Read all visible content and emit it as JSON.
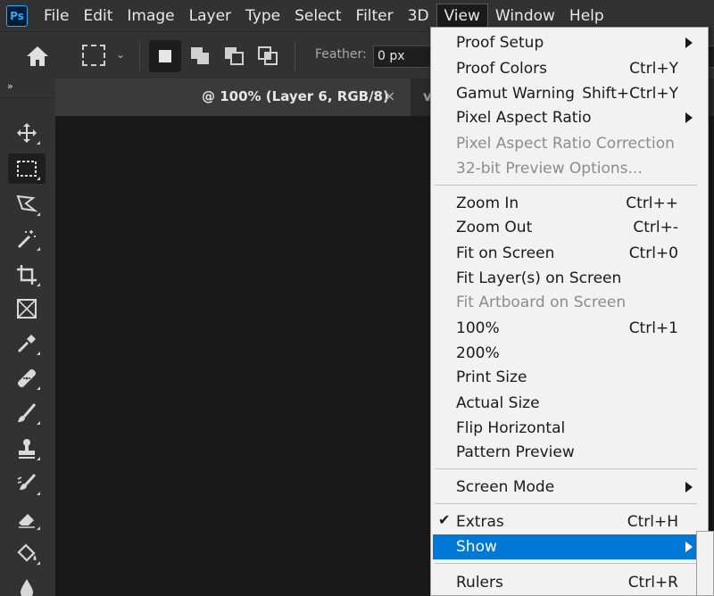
{
  "app": {
    "logo": "Ps"
  },
  "menubar": {
    "items": [
      "File",
      "Edit",
      "Image",
      "Layer",
      "Type",
      "Select",
      "Filter",
      "3D",
      "View",
      "Window",
      "Help"
    ],
    "active": "View"
  },
  "options": {
    "feather_label": "Feather:",
    "feather_value": "0 px"
  },
  "tools": {
    "collapse": "»",
    "items": [
      {
        "name": "move-tool-icon"
      },
      {
        "name": "rectangular-marquee-tool-icon",
        "selected": true
      },
      {
        "name": "lasso-tool-icon"
      },
      {
        "name": "magic-wand-tool-icon"
      },
      {
        "name": "crop-tool-icon"
      },
      {
        "name": "frame-tool-icon"
      },
      {
        "name": "eyedropper-tool-icon"
      },
      {
        "name": "spot-healing-brush-icon"
      },
      {
        "name": "brush-tool-icon"
      },
      {
        "name": "clone-stamp-tool-icon"
      },
      {
        "name": "history-brush-icon"
      },
      {
        "name": "eraser-tool-icon"
      },
      {
        "name": "paint-bucket-icon"
      },
      {
        "name": "blur-tool-icon"
      }
    ]
  },
  "document": {
    "tab_label": "@ 100% (Layer 6, RGB/8)",
    "tab_close": "×",
    "second_tab": "v"
  },
  "view_menu": {
    "proof_setup": "Proof Setup",
    "proof_colors": "Proof Colors",
    "proof_colors_sc": "Ctrl+Y",
    "gamut_warning": "Gamut Warning",
    "gamut_warning_sc": "Shift+Ctrl+Y",
    "pixel_aspect_ratio": "Pixel Aspect Ratio",
    "pixel_aspect_ratio_correction": "Pixel Aspect Ratio Correction",
    "preview_options": "32-bit Preview Options...",
    "zoom_in": "Zoom In",
    "zoom_in_sc": "Ctrl++",
    "zoom_out": "Zoom Out",
    "zoom_out_sc": "Ctrl+-",
    "fit_on_screen": "Fit on Screen",
    "fit_on_screen_sc": "Ctrl+0",
    "fit_layers": "Fit Layer(s) on Screen",
    "fit_artboard": "Fit Artboard on Screen",
    "zoom_100": "100%",
    "zoom_100_sc": "Ctrl+1",
    "zoom_200": "200%",
    "print_size": "Print Size",
    "actual_size": "Actual Size",
    "flip_horizontal": "Flip Horizontal",
    "pattern_preview": "Pattern Preview",
    "screen_mode": "Screen Mode",
    "extras": "Extras",
    "extras_sc": "Ctrl+H",
    "extras_check": "✔",
    "show": "Show",
    "rulers": "Rulers",
    "rulers_sc": "Ctrl+R"
  }
}
